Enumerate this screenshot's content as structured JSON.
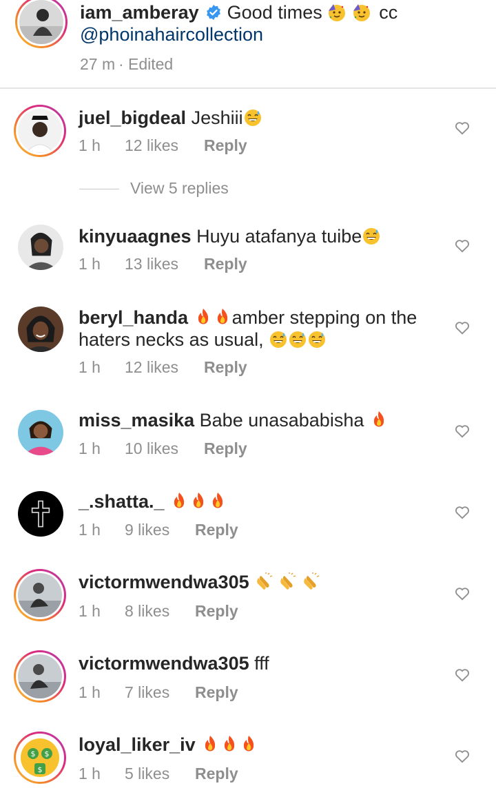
{
  "caption": {
    "username": "iam_amberay",
    "verified_icon": "verified-badge-icon",
    "text": "Good times",
    "suffix": "cc",
    "mention": "@phoinahaircollection",
    "time": "27 m",
    "separator": "·",
    "edited": "Edited"
  },
  "comments": [
    {
      "username": "juel_bigdeal",
      "text": "Jeshiii",
      "line2": "",
      "time": "1 h",
      "likes": "12 likes",
      "reply": "Reply"
    },
    {
      "username": "kinyuaagnes",
      "text": "Huyu atafanya tuibe",
      "line2": "",
      "time": "1 h",
      "likes": "13 likes",
      "reply": "Reply"
    },
    {
      "username": "beryl_handa",
      "text": "amber stepping on the",
      "line2": "haters necks as usual,",
      "time": "1 h",
      "likes": "12 likes",
      "reply": "Reply"
    },
    {
      "username": "miss_masika",
      "text": "Babe unasababisha",
      "line2": "",
      "time": "1 h",
      "likes": "10 likes",
      "reply": "Reply"
    },
    {
      "username": "_.shatta._",
      "text": "",
      "line2": "",
      "time": "1 h",
      "likes": "9 likes",
      "reply": "Reply"
    },
    {
      "username": "victormwendwa305",
      "text": "",
      "line2": "",
      "time": "1 h",
      "likes": "8 likes",
      "reply": "Reply"
    },
    {
      "username": "victormwendwa305",
      "text": "fff",
      "line2": "",
      "time": "1 h",
      "likes": "7 likes",
      "reply": "Reply"
    },
    {
      "username": "loyal_liker_iv",
      "text": "",
      "line2": "",
      "time": "1 h",
      "likes": "5 likes",
      "reply": "Reply"
    }
  ],
  "view_replies": "View 5 replies",
  "colors": {
    "text": "#262626",
    "muted": "#8e8e8e",
    "mention": "#00376b",
    "verified": "#3897f0",
    "story_ring": [
      "#f9c33a",
      "#dd2a7b"
    ]
  }
}
